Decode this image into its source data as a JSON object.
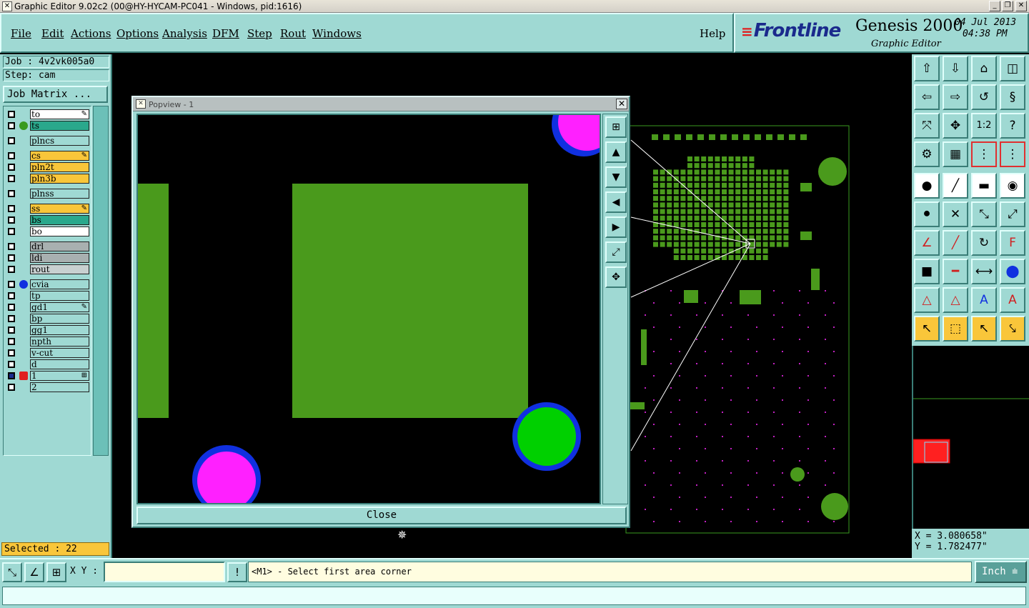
{
  "window": {
    "title": "Graphic Editor 9.02c2 (00@HY-HYCAM-PC041 - Windows, pid:1616)"
  },
  "menu": {
    "items": [
      "File",
      "Edit",
      "Actions",
      "Options",
      "Analysis",
      "DFM",
      "Step",
      "Rout",
      "Windows"
    ],
    "help": "Help"
  },
  "brand": {
    "logo": "Frontline",
    "product": "Genesis 2000",
    "subtitle": "Graphic Editor",
    "date": "04 Jul 2013",
    "time": "04:38 PM"
  },
  "job": {
    "job_line": "Job : 4v2vk005a0",
    "step_line": "Step: cam",
    "matrix_button": "Job Matrix ...",
    "selected": "Selected : 22"
  },
  "layers": [
    {
      "name": "to",
      "color": "#ffffff",
      "mark": "✎"
    },
    {
      "name": "ts",
      "color": "#2aa88c",
      "mark": "",
      "dot": "#3a9a20"
    },
    {
      "name": "plncs",
      "color": "#9fd9d3",
      "mark": ""
    },
    {
      "name": "cs",
      "color": "#f9c63a",
      "mark": "✎"
    },
    {
      "name": "pln2t",
      "color": "#f9c63a",
      "mark": ""
    },
    {
      "name": "pln3b",
      "color": "#f9c63a",
      "mark": ""
    },
    {
      "name": "plnss",
      "color": "#9fd9d3",
      "mark": ""
    },
    {
      "name": "ss",
      "color": "#f9c63a",
      "mark": "✎"
    },
    {
      "name": "bs",
      "color": "#2aa88c",
      "mark": ""
    },
    {
      "name": "bo",
      "color": "#ffffff",
      "mark": ""
    },
    {
      "name": "drl",
      "color": "#a8b0b0",
      "mark": ""
    },
    {
      "name": "ldi",
      "color": "#a8b0b0",
      "mark": ""
    },
    {
      "name": "rout",
      "color": "#c8d0d0",
      "mark": ""
    },
    {
      "name": "cvia",
      "color": "#9fd9d3",
      "mark": "",
      "dot": "#1030e0"
    },
    {
      "name": "tp",
      "color": "#9fd9d3",
      "mark": ""
    },
    {
      "name": "gd1",
      "color": "#9fd9d3",
      "mark": "✎"
    },
    {
      "name": "bp",
      "color": "#9fd9d3",
      "mark": ""
    },
    {
      "name": "gg1",
      "color": "#9fd9d3",
      "mark": ""
    },
    {
      "name": "npth",
      "color": "#9fd9d3",
      "mark": ""
    },
    {
      "name": "v-cut",
      "color": "#9fd9d3",
      "mark": ""
    },
    {
      "name": "d",
      "color": "#9fd9d3",
      "mark": ""
    },
    {
      "name": "1",
      "color": "#9fd9d3",
      "mark": "⊞"
    },
    {
      "name": "2",
      "color": "#9fd9d3",
      "mark": ""
    }
  ],
  "popview": {
    "title": "Popview - 1",
    "close_label": "Close"
  },
  "coords": {
    "x": "X = 3.080658\"",
    "y": "Y = 1.782477\""
  },
  "bottom": {
    "xy_label": "X Y :",
    "xy_value": "",
    "message": "<M1> - Select first area corner",
    "unit": "Inch"
  },
  "colors": {
    "panel": "#9fd9d3",
    "copper": "#4a9a1c",
    "pad_magenta": "#ff20ff",
    "via_blue": "#1030e0",
    "pad_green": "#00d000"
  }
}
